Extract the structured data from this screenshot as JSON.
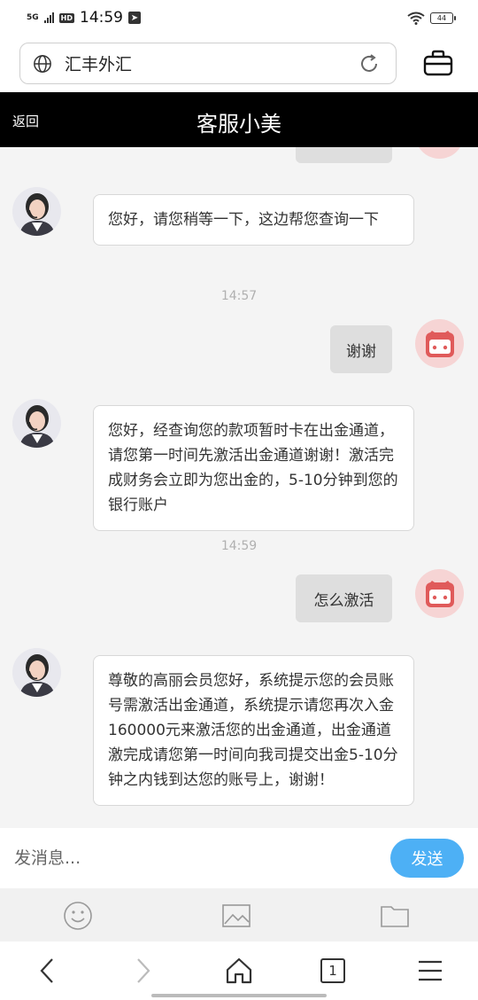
{
  "status": {
    "network": "5G",
    "hd": "HD",
    "time": "14:59",
    "battery": "44"
  },
  "browser": {
    "url_text": "汇丰外汇",
    "tab_count": "1"
  },
  "header": {
    "back_label": "返回",
    "title": "客服小美"
  },
  "chat": {
    "messages": [
      {
        "side": "left",
        "text": "您好，请您稍等一下，这边帮您查询一下"
      },
      {
        "timestamp": "14:57"
      },
      {
        "side": "right",
        "text": "谢谢"
      },
      {
        "side": "left",
        "text": "您好，经查询您的款项暂时卡在出金通道，请您第一时间先激活出金通道谢谢！激活完成财务会立即为您出金的，5-10分钟到您的银行账户"
      },
      {
        "timestamp": "14:59"
      },
      {
        "side": "right",
        "text": "怎么激活"
      },
      {
        "side": "left",
        "text": "尊敬的高丽会员您好，系统提示您的会员账号需激活出金通道，系统提示请您再次入金160000元来激活您的出金通道，出金通道激完成请您第一时间向我司提交出金5-10分钟之内钱到达您的账号上，谢谢！"
      }
    ]
  },
  "composer": {
    "placeholder": "发消息...",
    "send_label": "发送"
  },
  "colors": {
    "header_bg": "#000000",
    "send_button": "#4db0f5",
    "chat_bg": "#f4f4f4",
    "user_avatar": "#e05a5a"
  },
  "icons": [
    "globe-icon",
    "reload-icon",
    "briefcase-icon",
    "emoji-icon",
    "image-icon",
    "folder-icon",
    "back-arrow-icon",
    "forward-arrow-icon",
    "home-icon",
    "tabs-icon",
    "menu-icon"
  ]
}
